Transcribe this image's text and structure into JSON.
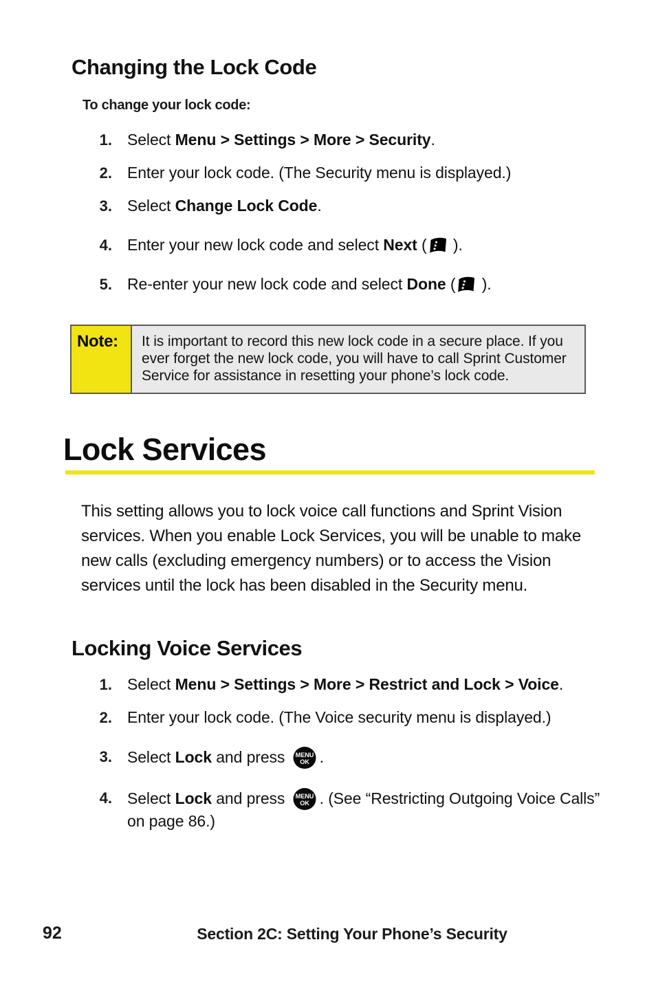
{
  "document": {
    "page_number": "92",
    "footer_section": "Section 2C: Setting Your Phone’s Security"
  },
  "colors": {
    "accent_yellow": "#f0e515",
    "note_label_bg": "#f2e312",
    "note_body_bg": "#e9e9e9",
    "note_border": "#5a5a5a",
    "text": "#111111"
  },
  "section_change_lock_code": {
    "heading": "Changing the Lock Code",
    "lead_in": "To change your lock code:",
    "steps": [
      {
        "num": "1.",
        "parts": [
          {
            "text": "Select ",
            "bold": false
          },
          {
            "text": "Menu > Settings > More > Security",
            "bold": true
          },
          {
            "text": ".",
            "bold": false
          }
        ]
      },
      {
        "num": "2.",
        "parts": [
          {
            "text": "Enter your lock code. (The Security menu is displayed.)",
            "bold": false
          }
        ]
      },
      {
        "num": "3.",
        "parts": [
          {
            "text": "Select ",
            "bold": false
          },
          {
            "text": "Change Lock Code",
            "bold": true
          },
          {
            "text": ".",
            "bold": false
          }
        ]
      },
      {
        "num": "4.",
        "parts": [
          {
            "text": "Enter your new lock code and select ",
            "bold": false
          },
          {
            "text": "Next",
            "bold": true
          },
          {
            "text": " (",
            "bold": false
          },
          {
            "icon": "softkey-icon"
          },
          {
            "text": " ).",
            "bold": false
          }
        ]
      },
      {
        "num": "5.",
        "parts": [
          {
            "text": "Re-enter your new lock code and select ",
            "bold": false
          },
          {
            "text": "Done",
            "bold": true
          },
          {
            "text": " (",
            "bold": false
          },
          {
            "icon": "softkey-icon"
          },
          {
            "text": " ).",
            "bold": false
          }
        ]
      }
    ],
    "note": {
      "label": "Note:",
      "body": "It is important to record this new lock code in a secure place. If you ever forget the new lock code, you will have to call Sprint Customer Service for assistance in resetting your phone’s lock code."
    }
  },
  "section_lock_services": {
    "heading": "Lock Services",
    "paragraph": "This setting allows you to lock voice call functions and Sprint Vision services. When you enable Lock Services, you will be unable to make new calls (excluding emergency numbers) or to access the Vision services until the lock has been disabled in the Security menu."
  },
  "section_locking_voice_services": {
    "heading": "Locking Voice Services",
    "steps": [
      {
        "num": "1.",
        "parts": [
          {
            "text": "Select ",
            "bold": false
          },
          {
            "text": "Menu > Settings > More > Restrict and Lock > Voice",
            "bold": true
          },
          {
            "text": ".",
            "bold": false
          }
        ]
      },
      {
        "num": "2.",
        "parts": [
          {
            "text": "Enter your lock code. (The Voice security menu is displayed.)",
            "bold": false
          }
        ]
      },
      {
        "num": "3.",
        "parts": [
          {
            "text": "Select ",
            "bold": false
          },
          {
            "text": "Lock",
            "bold": true
          },
          {
            "text": " and press ",
            "bold": false
          },
          {
            "icon": "menu-ok-icon"
          },
          {
            "text": ".",
            "bold": false
          }
        ]
      },
      {
        "num": "4.",
        "parts": [
          {
            "text": "Select ",
            "bold": false
          },
          {
            "text": "Lock",
            "bold": true
          },
          {
            "text": " and press ",
            "bold": false
          },
          {
            "icon": "menu-ok-icon"
          },
          {
            "text": ". (See “Restricting Outgoing Voice Calls” on page 86.)",
            "bold": false
          }
        ]
      }
    ]
  },
  "icons": {
    "menu_ok_line1": "MENU",
    "menu_ok_line2": "OK"
  }
}
